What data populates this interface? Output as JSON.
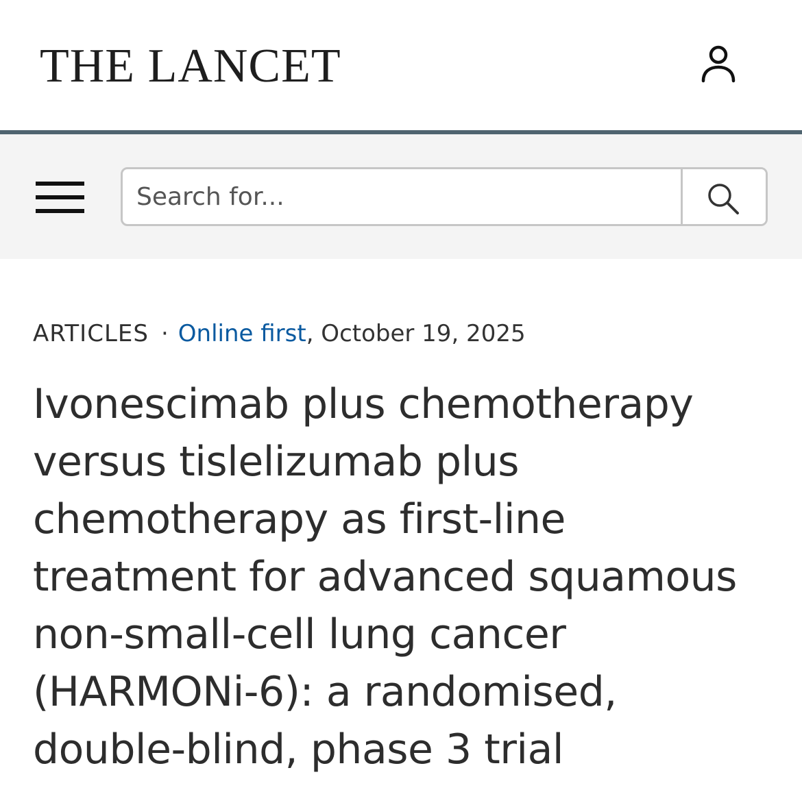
{
  "header": {
    "logo_text": "THE LANCET",
    "user_icon": "user-icon"
  },
  "nav": {
    "menu_icon": "hamburger-menu-icon",
    "search": {
      "placeholder": "Search for...",
      "value": "",
      "button_icon": "search-icon"
    }
  },
  "article": {
    "type": "ARTICLES",
    "separator": "·",
    "status_link": "Online first",
    "date": ", October 19, 2025",
    "title": "Ivonescimab plus chemotherapy versus tislelizumab plus chemotherapy as first-line treatment for advanced squamous non-small-cell lung cancer (HARMONi-6): a randomised, double-blind, phase 3 trial"
  },
  "colors": {
    "header_rule": "#4f6470",
    "nav_background": "#f4f4f4",
    "link": "#0a5aa0",
    "text": "#2d2d2d"
  }
}
